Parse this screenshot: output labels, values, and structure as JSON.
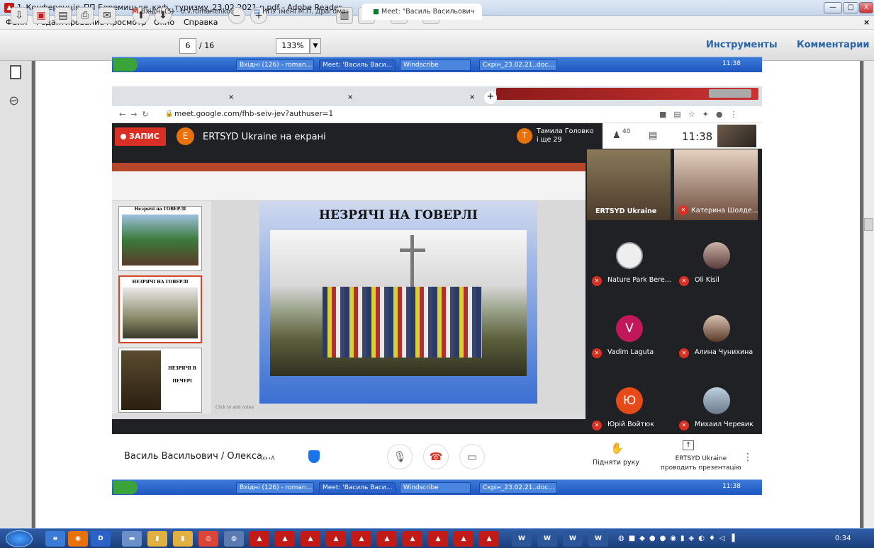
{
  "window": {
    "title": "1_Конференція_ПП Беремицьке_каф._туризму_23.02.2021 р.pdf - Adobe Reader",
    "controls": [
      "—",
      "▢",
      "X"
    ]
  },
  "menu": [
    "Файл",
    "Редактирование",
    "Просмотр",
    "Окно",
    "Справка"
  ],
  "menu_close": "×",
  "toolbar": {
    "page_current": "6",
    "page_total": "/ 16",
    "zoom": "133%",
    "tools": "Инструменты",
    "comments": "Комментарии"
  },
  "xp_taskbar": {
    "items": [
      "Вхідні (126) - roman...",
      "Meet: 'Василь Васи...",
      "Windscribe",
      "Скрін_23.02.21..doc..."
    ],
    "clock": "11:38"
  },
  "browser": {
    "tabs": [
      "Вхідні (5) - o.v.romanenko@npu",
      "НПУ імені М.П. Драгоманова",
      "Meet: \"Василь Васильович"
    ],
    "tab_close": "×",
    "new_tab": "+",
    "url": "meet.google.com/fhb-seiv-jev?authuser=1"
  },
  "meet": {
    "record": "ЗАПИС",
    "presenter_initial": "E",
    "presenter_title": "ERTSYD Ukraine на екрані",
    "joiner_initial": "Т",
    "joiner_line1": "Тамила Головко",
    "joiner_line2": "і ще 29",
    "participant_count": "40",
    "clock": "11:38",
    "bottom_name": "Василь Васильович / Олекса...",
    "raise_hand": "Підняти руку",
    "presenting_line1": "ERTSYD Ukraine",
    "presenting_line2": "проводить презентацію",
    "participants": [
      {
        "name": "ERTSYD Ukraine",
        "type": "video"
      },
      {
        "name": "Катерина Шолде...",
        "type": "video"
      },
      {
        "name": "Nature Park Bere...",
        "type": "logo"
      },
      {
        "name": "Oli Kisil",
        "type": "photo"
      },
      {
        "name": "Vadim Laguta",
        "type": "avatar",
        "initial": "V",
        "color": "#c2185b"
      },
      {
        "name": "Алина Чунихина",
        "type": "photo"
      },
      {
        "name": "Юрій Войтюк",
        "type": "avatar",
        "initial": "Ю",
        "color": "#e64a19"
      },
      {
        "name": "Михаил Черевик",
        "type": "photo"
      }
    ]
  },
  "slide": {
    "title": "НЕЗРЯЧІ НА ГОВЕРЛІ",
    "thumbs": [
      "Незрячі на ГОВЕРЛІ",
      "НЕЗРЯЧІ НА ГОВЕРЛІ",
      "НЕЗРЯЧІ В ПЕЧЕРІ"
    ],
    "notes": "Click to add notes"
  },
  "win_taskbar": {
    "clock": "0:34"
  }
}
